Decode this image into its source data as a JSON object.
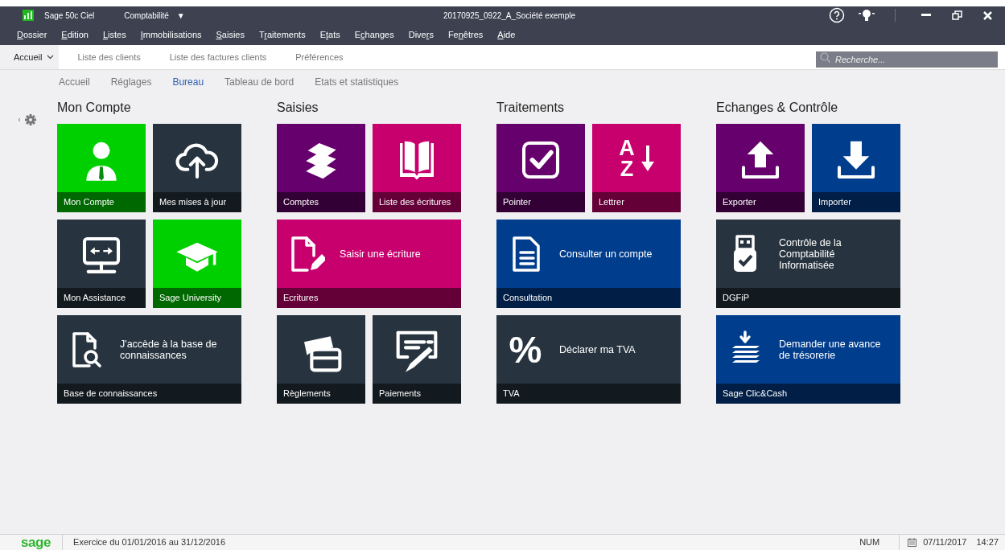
{
  "window": {
    "app_name": "Sage 50c Ciel",
    "module": "Comptabilité",
    "module_caret": "▼",
    "title": "20170925_0922_A_Société exemple"
  },
  "menu": [
    {
      "key": "D",
      "after": "ossier"
    },
    {
      "key": "E",
      "after": "dition"
    },
    {
      "key": "L",
      "after": "istes"
    },
    {
      "key": "I",
      "after": "mmobilisations"
    },
    {
      "key": "S",
      "after": "aisies"
    },
    {
      "before": "T",
      "key": "r",
      "after": "aitements"
    },
    {
      "before": "E",
      "key": "t",
      "after": "ats"
    },
    {
      "before": "E",
      "key": "c",
      "after": "hanges"
    },
    {
      "before": "Dive",
      "key": "r",
      "after": "s"
    },
    {
      "before": "Fe",
      "key": "n",
      "after": "êtres"
    },
    {
      "key": "A",
      "after": "ide"
    }
  ],
  "tabs": {
    "home": "Accueil",
    "items": [
      "Liste des clients",
      "Liste des factures clients",
      "Préférences"
    ]
  },
  "search": {
    "placeholder": "Recherche..."
  },
  "subnav": [
    {
      "label": "Accueil",
      "selected": false
    },
    {
      "label": "Réglages",
      "selected": false
    },
    {
      "label": "Bureau",
      "selected": true
    },
    {
      "label": "Tableau de bord",
      "selected": false
    },
    {
      "label": "Etats et statistiques",
      "selected": false
    }
  ],
  "sections": [
    {
      "title": "Mon Compte",
      "tiles": [
        {
          "kind": "small",
          "caption": "Mon Compte",
          "color": "#00d000"
        },
        {
          "kind": "small",
          "caption": "Mes mises à jour",
          "color": "#27343f"
        },
        {
          "kind": "small",
          "caption": "Mon Assistance",
          "color": "#27343f"
        },
        {
          "kind": "small",
          "caption": "Sage University",
          "color": "#00d000"
        },
        {
          "kind": "wide",
          "caption": "Base de connaissances",
          "text": "J'accède à la base de connaissances",
          "color": "#27343f"
        }
      ]
    },
    {
      "title": "Saisies",
      "tiles": [
        {
          "kind": "small",
          "caption": "Comptes",
          "color": "#66006c"
        },
        {
          "kind": "small",
          "caption": "Liste des écritures",
          "color": "#c8006e"
        },
        {
          "kind": "wide",
          "caption": "Ecritures",
          "text": "Saisir une écriture",
          "color": "#c8006e"
        },
        {
          "kind": "small",
          "caption": "Règlements",
          "color": "#27343f"
        },
        {
          "kind": "small",
          "caption": "Paiements",
          "color": "#27343f"
        }
      ]
    },
    {
      "title": "Traitements",
      "tiles": [
        {
          "kind": "small",
          "caption": "Pointer",
          "color": "#66006c"
        },
        {
          "kind": "small",
          "caption": "Lettrer",
          "color": "#c8006e",
          "icon_letters": [
            "A",
            "Z"
          ]
        },
        {
          "kind": "wide",
          "caption": "Consultation",
          "text": "Consulter un compte",
          "color": "#003d8c"
        },
        {
          "kind": "wide",
          "caption": "TVA",
          "text": "Déclarer ma TVA",
          "color": "#27343f",
          "icon_char": "%"
        }
      ]
    },
    {
      "title": "Echanges & Contrôle",
      "tiles": [
        {
          "kind": "small",
          "caption": "Exporter",
          "color": "#66006c"
        },
        {
          "kind": "small",
          "caption": "Importer",
          "color": "#003d8c"
        },
        {
          "kind": "wide",
          "caption": "DGFiP",
          "text": "Contrôle de la Comptabilité Informatisée",
          "color": "#27343f"
        },
        {
          "kind": "wide",
          "caption": "Sage Clic&Cash",
          "text": "Demander une avance de trésorerie",
          "color": "#003d8c"
        }
      ]
    }
  ],
  "status_bar": {
    "logo": "sage",
    "exercise": "Exercice du 01/01/2016 au 31/12/2016",
    "num": "NUM",
    "date": "07/11/2017",
    "time": "14:27"
  }
}
